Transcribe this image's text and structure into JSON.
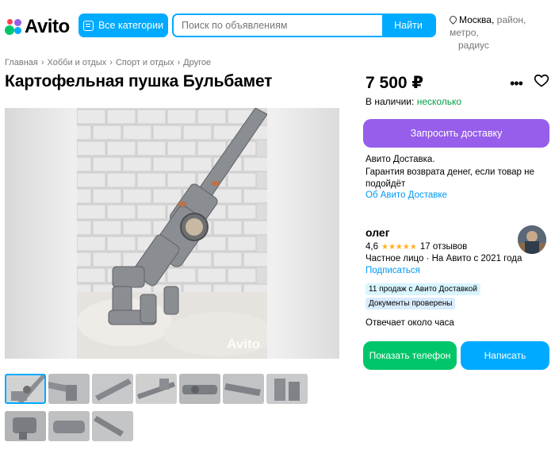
{
  "header": {
    "logo_text": "Avito",
    "categories_label": "Все категории",
    "search_placeholder": "Поиск по объявлениям",
    "search_button": "Найти",
    "location_city": "Москва,",
    "location_rest_1": "район, метро,",
    "location_rest_2": "радиус"
  },
  "breadcrumb": [
    "Главная",
    "Хобби и отдых",
    "Спорт и отдых",
    "Другое"
  ],
  "listing": {
    "title": "Картофельная пушка Бульбамет",
    "watermark": "Avito",
    "price": "7 500 ₽",
    "stock_label": "В наличии:",
    "stock_value": "несколько",
    "thumbnail_count": 10,
    "active_thumbnail": 1
  },
  "delivery": {
    "button": "Запросить доставку",
    "line1": "Авито Доставка.",
    "line2": "Гарантия возврата денег, если товар не подойдёт",
    "link": "Об Авито Доставке"
  },
  "seller": {
    "name": "олег",
    "rating": "4,6",
    "stars": "★★★★★",
    "reviews": "17 отзывов",
    "type": "Частное лицо · На Авито с 2021 года",
    "subscribe": "Подписаться",
    "badge_sales": "11 продаж с Авито Доставкой",
    "badge_docs": "Документы проверены",
    "reply_time": "Отвечает около часа"
  },
  "actions": {
    "phone": "Показать телефон",
    "write": "Написать"
  },
  "colors": {
    "accent": "#00aaff",
    "delivery": "#965eeb",
    "phone": "#00c66a",
    "link": "#0099f7",
    "in_stock": "#00a046",
    "stars": "#ffb021"
  },
  "icons": [
    "avito-logo-icon",
    "categories-icon",
    "location-pin-icon",
    "more-icon",
    "heart-icon"
  ]
}
